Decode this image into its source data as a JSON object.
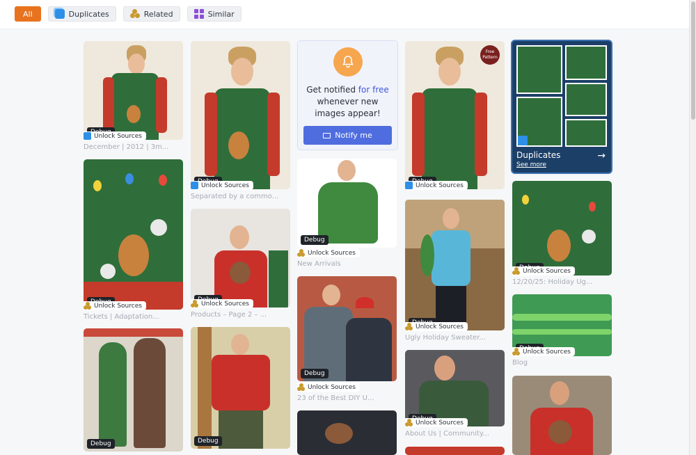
{
  "filters": [
    {
      "label": "All",
      "icon": ""
    },
    {
      "label": "Duplicates",
      "icon": "duplicates-icon"
    },
    {
      "label": "Related",
      "icon": "related-icon"
    },
    {
      "label": "Similar",
      "icon": "similar-icon"
    }
  ],
  "badge": "Debug",
  "unlock": "Unlock Sources",
  "captions": {
    "c1": "December | 2012 | 3m...",
    "c2": "Separated by a commo...",
    "c3": "New Arrivals",
    "c4": "Tickets | Adaptation...",
    "c5": "Products – Page 2 – ...",
    "c6": "23 of the Best DIY U...",
    "c7": "Ugly Holiday Sweater...",
    "c8": "About Us | Community...",
    "c9": "12/20/25: Holiday Ug...",
    "c10": "Blog"
  },
  "notify": {
    "line1": "Get notified ",
    "highlight": "for free",
    "line2": "whenever new images appear!",
    "button": "Notify me"
  },
  "duplicates_card": {
    "title": "Duplicates",
    "link": "See more"
  },
  "free_pattern": "Free Pattern",
  "colors": {
    "accent": "#e8731f",
    "notify_button": "#4f6ddf",
    "duplicates_bg": "#1c3f67"
  }
}
